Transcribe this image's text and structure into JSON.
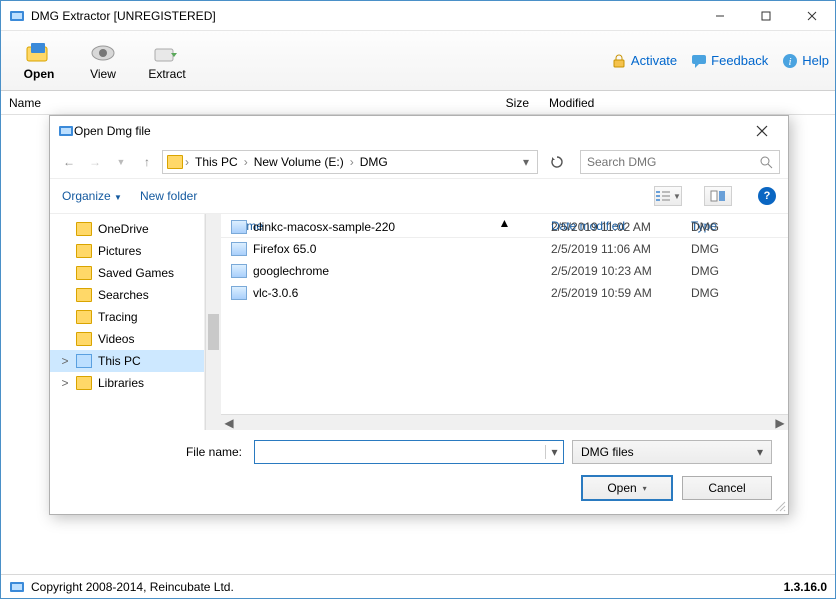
{
  "titlebar": {
    "title": "DMG Extractor [UNREGISTERED]"
  },
  "ribbon": {
    "open": "Open",
    "view": "View",
    "extract": "Extract",
    "activate": "Activate",
    "feedback": "Feedback",
    "help": "Help"
  },
  "colheaders": {
    "name": "Name",
    "size": "Size",
    "modified": "Modified"
  },
  "dialog": {
    "title": "Open Dmg file",
    "breadcrumb": {
      "root_icon": "folder",
      "p1": "This PC",
      "p2": "New Volume (E:)",
      "p3": "DMG"
    },
    "search_placeholder": "Search DMG",
    "organize": "Organize",
    "newfolder": "New folder",
    "tree": [
      {
        "label": "OneDrive",
        "icon": "cloud"
      },
      {
        "label": "Pictures",
        "icon": "folder"
      },
      {
        "label": "Saved Games",
        "icon": "folder"
      },
      {
        "label": "Searches",
        "icon": "folder"
      },
      {
        "label": "Tracing",
        "icon": "folder"
      },
      {
        "label": "Videos",
        "icon": "folder"
      },
      {
        "label": "This PC",
        "icon": "pc",
        "selected": true,
        "expander": ">"
      },
      {
        "label": "Libraries",
        "icon": "folder",
        "expander": ">"
      }
    ],
    "listheaders": {
      "name": "Name",
      "date": "Date modified",
      "type": "Type"
    },
    "rows": [
      {
        "name": "clinkc-macosx-sample-220",
        "date": "2/5/2019 11:02 AM",
        "type": "DMG"
      },
      {
        "name": "Firefox 65.0",
        "date": "2/5/2019 11:06 AM",
        "type": "DMG"
      },
      {
        "name": "googlechrome",
        "date": "2/5/2019 10:23 AM",
        "type": "DMG"
      },
      {
        "name": "vlc-3.0.6",
        "date": "2/5/2019 10:59 AM",
        "type": "DMG"
      }
    ],
    "filename_label": "File name:",
    "filename_value": "",
    "filetype": "DMG files",
    "open_btn": "Open",
    "cancel_btn": "Cancel"
  },
  "status": {
    "copyright": "Copyright 2008-2014, Reincubate Ltd.",
    "version": "1.3.16.0"
  }
}
